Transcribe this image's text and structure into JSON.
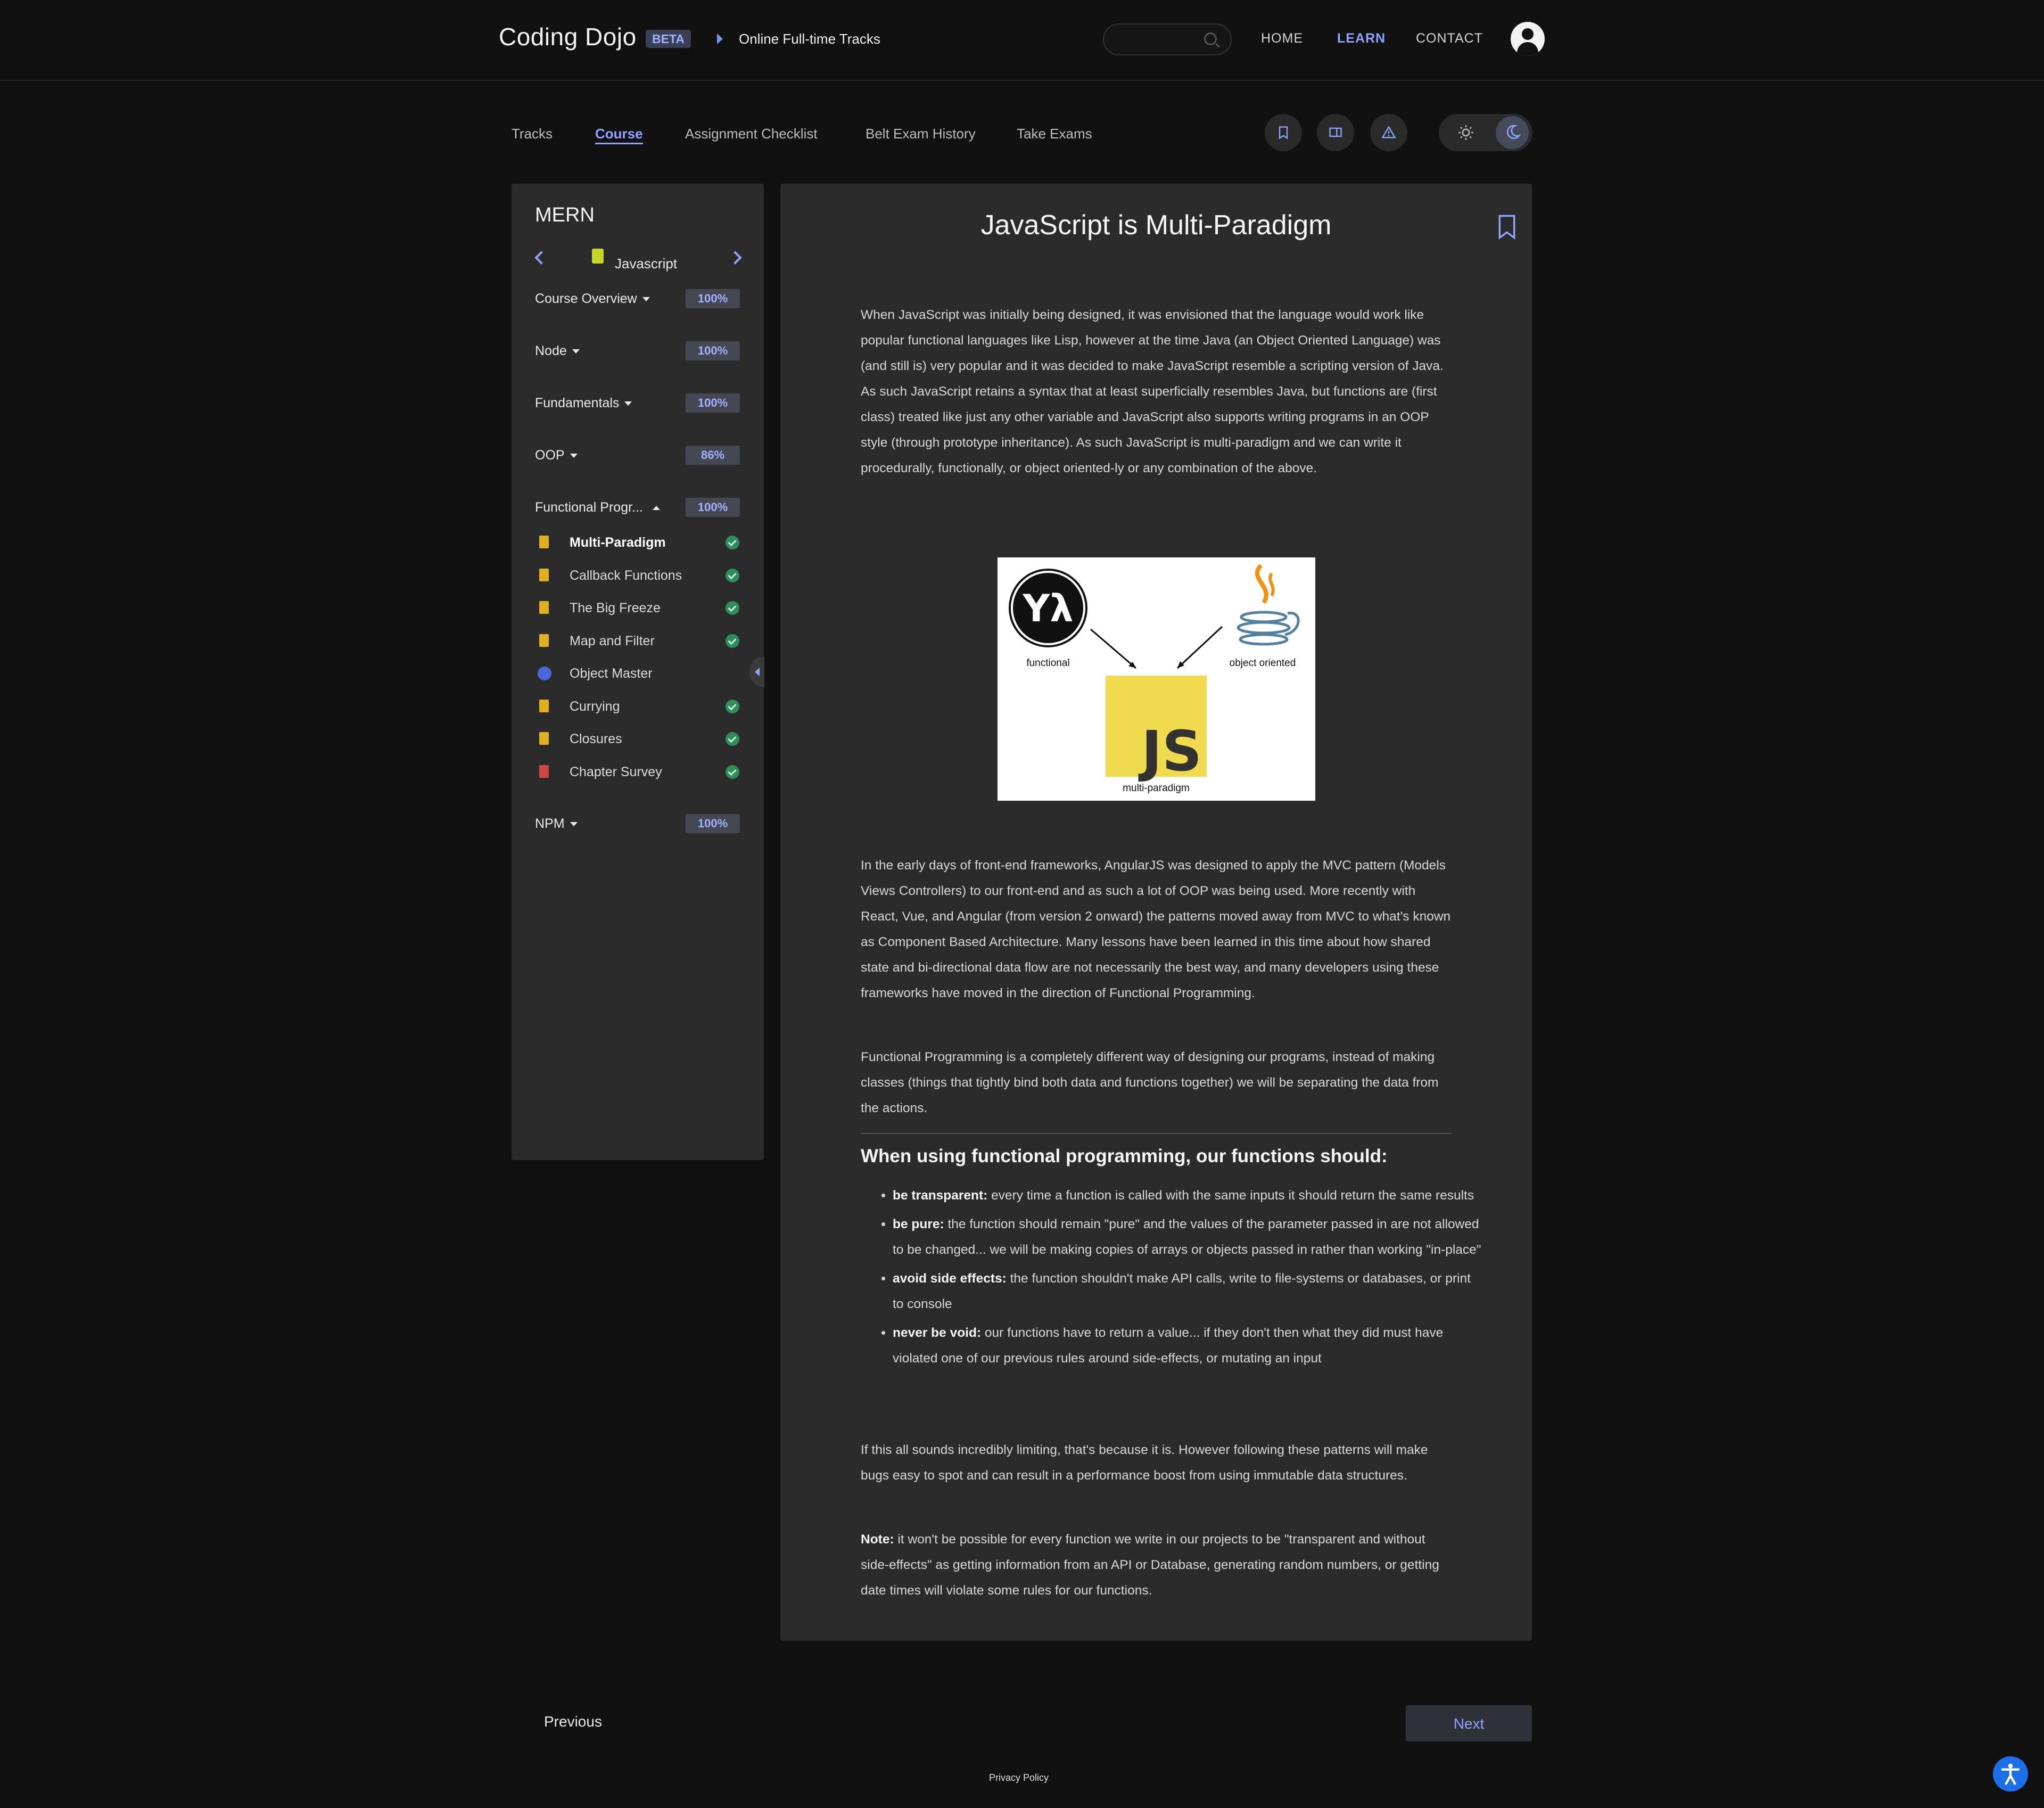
{
  "header": {
    "brand": "Coding Dojo",
    "badge": "BETA",
    "breadcrumb": "Online Full-time Tracks",
    "search_placeholder": "",
    "nav": [
      "HOME",
      "LEARN",
      "CONTACT"
    ],
    "active_nav": "LEARN"
  },
  "subnav": {
    "tabs": [
      "Tracks",
      "Course",
      "Assignment Checklist",
      "Belt Exam History",
      "Take Exams"
    ],
    "active_tab": "Course",
    "tools": [
      "bookmark-icon",
      "book-icon",
      "warning-icon"
    ],
    "theme": {
      "options": [
        "sun-icon",
        "moon-icon"
      ],
      "selected": "dark"
    }
  },
  "sidebar": {
    "title": "MERN",
    "module": "Javascript",
    "sections": [
      {
        "label": "Course Overview",
        "pct": "100%"
      },
      {
        "label": "Node",
        "pct": "100%"
      },
      {
        "label": "Fundamentals",
        "pct": "100%"
      },
      {
        "label": "OOP",
        "pct": "86%"
      },
      {
        "label": "Functional Progr...",
        "pct": "100%"
      },
      {
        "label": "NPM",
        "pct": "100%"
      }
    ],
    "lessons": [
      {
        "label": "Multi-Paradigm",
        "done": true
      },
      {
        "label": "Callback Functions",
        "done": true
      },
      {
        "label": "The Big Freeze",
        "done": true
      },
      {
        "label": "Map and Filter",
        "done": true
      },
      {
        "label": "Object Master",
        "done": false
      },
      {
        "label": "Currying",
        "done": true
      },
      {
        "label": "Closures",
        "done": true
      },
      {
        "label": "Chapter Survey",
        "done": true
      }
    ]
  },
  "content": {
    "title": "JavaScript is Multi-Paradigm",
    "intro": "When JavaScript was initially being designed, it was envisioned that the language would work like popular functional languages like Lisp, however at the time Java (an Object Oriented Language) was (and still is) very popular and it was decided to make JavaScript resemble a scripting version of Java. As such JavaScript retains a syntax that at least superficially resembles Java, but functions are (first class) treated like just any other variable and JavaScript also supports writing programs in an OOP style (through prototype inheritance). As such JavaScript is multi-paradigm and we can write it procedurally, functionally, or object oriented-ly or any combination of the above.",
    "figure": {
      "functional": "functional",
      "object_oriented": "object oriented",
      "js": "JS",
      "multi": "multi-paradigm"
    },
    "para2": "In the early days of front-end frameworks, AngularJS was designed to apply the MVC pattern (Models Views Controllers) to our front-end and as such a lot of OOP was being used. More recently with React, Vue, and Angular (from version 2 onward) the patterns moved away from MVC to what's known as Component Based Architecture. Many lessons have been learned in this time about how shared state and bi-directional data flow are not necessarily the best way, and many developers using these frameworks have moved in the direction of Functional Programming.",
    "para3": "Functional Programming is a completely different way of designing our programs, instead of making classes (things that tightly bind both data and functions together) we will be separating the data from the actions.",
    "heading": "When using functional programming, our functions should:",
    "bullets": [
      {
        "term": "be transparent:",
        "text": " every time a function is called with the same inputs it should return the same results"
      },
      {
        "term": "be pure:",
        "text": " the function should remain \"pure\" and the values of the parameter passed in are not allowed to be changed... we will be making copies of arrays or objects passed in rather than working \"in-place\""
      },
      {
        "term": "avoid side effects:",
        "text": " the function shouldn't make API calls, write to file-systems or databases, or print to console"
      },
      {
        "term": "never be void:",
        "text": " our functions have to return a value... if they don't then what they did must have violated one of our previous rules around side-effects, or mutating an input"
      }
    ],
    "para4": "If this all sounds incredibly limiting, that's because it is. However following these patterns will make bugs easy to spot and can result in a performance boost from using immutable data structures.",
    "note_term": "Note:",
    "note_text": " it won't be possible for every function we write in our projects to be \"transparent and without side-effects\" as getting information from an API or Database, generating random numbers, or getting date times will violate some rules for our functions."
  },
  "footer": {
    "previous": "Previous",
    "next": "Next",
    "privacy": "Privacy Policy"
  },
  "colors": {
    "accent": "#8fa3ff",
    "background": "#111111",
    "panel": "#2b2b2b",
    "success": "#2d8e5b"
  }
}
